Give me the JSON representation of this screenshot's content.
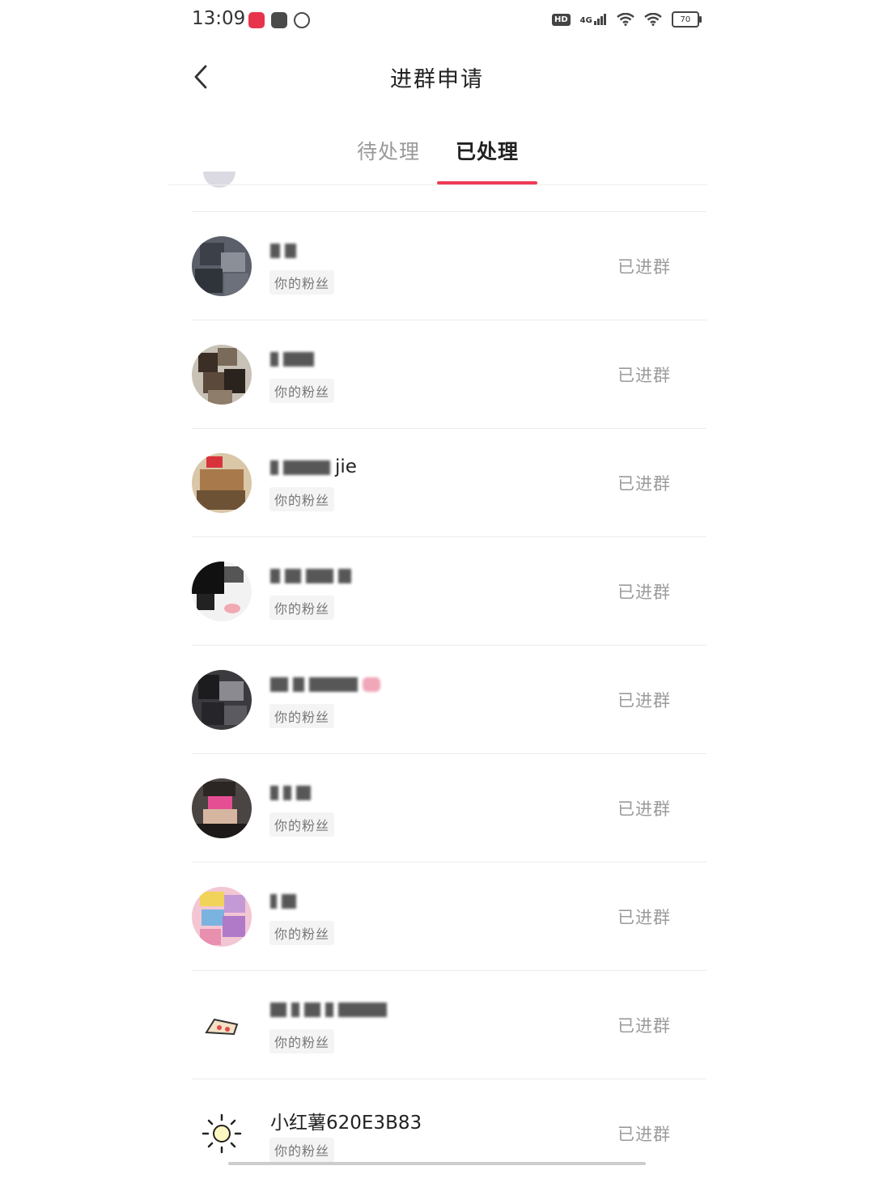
{
  "status_bar": {
    "time": "13:09",
    "hd": "HD",
    "network": "4G",
    "battery": "70"
  },
  "nav": {
    "title": "进群申请"
  },
  "tabs": [
    {
      "label": "待处理",
      "active": false
    },
    {
      "label": "已处理",
      "active": true
    }
  ],
  "colors": {
    "accent": "#ef3b55",
    "muted": "#9b9b9b"
  },
  "requests": [
    {
      "name": "",
      "name_visible_suffix": "",
      "tag": "你的粉丝",
      "status": "已进群"
    },
    {
      "name": "",
      "name_visible_suffix": "",
      "tag": "你的粉丝",
      "status": "已进群"
    },
    {
      "name": "",
      "name_visible_suffix": "jie",
      "tag": "你的粉丝",
      "status": "已进群"
    },
    {
      "name": "",
      "name_visible_suffix": "",
      "tag": "你的粉丝",
      "status": "已进群"
    },
    {
      "name": "",
      "name_visible_suffix": "",
      "tag": "你的粉丝",
      "status": "已进群"
    },
    {
      "name": "",
      "name_visible_suffix": "",
      "tag": "你的粉丝",
      "status": "已进群"
    },
    {
      "name": "",
      "name_visible_suffix": "",
      "tag": "你的粉丝",
      "status": "已进群"
    },
    {
      "name": "",
      "name_visible_suffix": "",
      "tag": "你的粉丝",
      "status": "已进群"
    },
    {
      "name": "小红薯620E3B83",
      "name_visible_suffix": "",
      "tag": "你的粉丝",
      "status": "已进群"
    }
  ]
}
